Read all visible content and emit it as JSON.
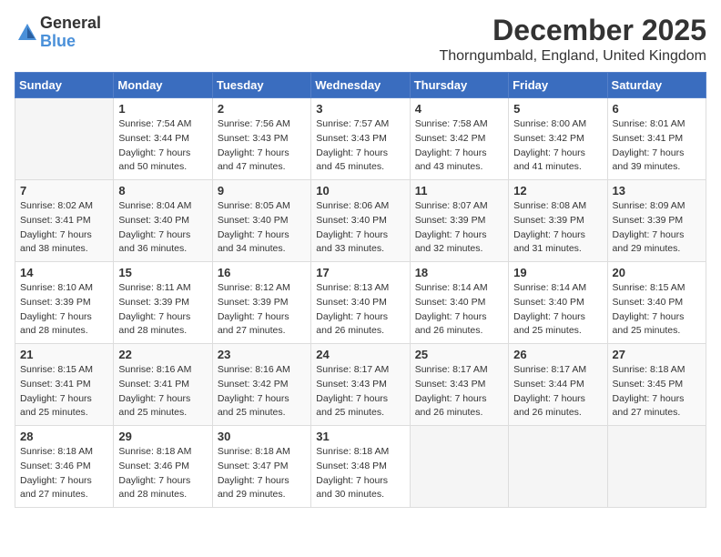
{
  "header": {
    "logo_general": "General",
    "logo_blue": "Blue",
    "month_year": "December 2025",
    "location": "Thorngumbald, England, United Kingdom"
  },
  "weekdays": [
    "Sunday",
    "Monday",
    "Tuesday",
    "Wednesday",
    "Thursday",
    "Friday",
    "Saturday"
  ],
  "weeks": [
    [
      {
        "day": "",
        "sunrise": "",
        "sunset": "",
        "daylight": ""
      },
      {
        "day": "1",
        "sunrise": "Sunrise: 7:54 AM",
        "sunset": "Sunset: 3:44 PM",
        "daylight": "Daylight: 7 hours and 50 minutes."
      },
      {
        "day": "2",
        "sunrise": "Sunrise: 7:56 AM",
        "sunset": "Sunset: 3:43 PM",
        "daylight": "Daylight: 7 hours and 47 minutes."
      },
      {
        "day": "3",
        "sunrise": "Sunrise: 7:57 AM",
        "sunset": "Sunset: 3:43 PM",
        "daylight": "Daylight: 7 hours and 45 minutes."
      },
      {
        "day": "4",
        "sunrise": "Sunrise: 7:58 AM",
        "sunset": "Sunset: 3:42 PM",
        "daylight": "Daylight: 7 hours and 43 minutes."
      },
      {
        "day": "5",
        "sunrise": "Sunrise: 8:00 AM",
        "sunset": "Sunset: 3:42 PM",
        "daylight": "Daylight: 7 hours and 41 minutes."
      },
      {
        "day": "6",
        "sunrise": "Sunrise: 8:01 AM",
        "sunset": "Sunset: 3:41 PM",
        "daylight": "Daylight: 7 hours and 39 minutes."
      }
    ],
    [
      {
        "day": "7",
        "sunrise": "Sunrise: 8:02 AM",
        "sunset": "Sunset: 3:41 PM",
        "daylight": "Daylight: 7 hours and 38 minutes."
      },
      {
        "day": "8",
        "sunrise": "Sunrise: 8:04 AM",
        "sunset": "Sunset: 3:40 PM",
        "daylight": "Daylight: 7 hours and 36 minutes."
      },
      {
        "day": "9",
        "sunrise": "Sunrise: 8:05 AM",
        "sunset": "Sunset: 3:40 PM",
        "daylight": "Daylight: 7 hours and 34 minutes."
      },
      {
        "day": "10",
        "sunrise": "Sunrise: 8:06 AM",
        "sunset": "Sunset: 3:40 PM",
        "daylight": "Daylight: 7 hours and 33 minutes."
      },
      {
        "day": "11",
        "sunrise": "Sunrise: 8:07 AM",
        "sunset": "Sunset: 3:39 PM",
        "daylight": "Daylight: 7 hours and 32 minutes."
      },
      {
        "day": "12",
        "sunrise": "Sunrise: 8:08 AM",
        "sunset": "Sunset: 3:39 PM",
        "daylight": "Daylight: 7 hours and 31 minutes."
      },
      {
        "day": "13",
        "sunrise": "Sunrise: 8:09 AM",
        "sunset": "Sunset: 3:39 PM",
        "daylight": "Daylight: 7 hours and 29 minutes."
      }
    ],
    [
      {
        "day": "14",
        "sunrise": "Sunrise: 8:10 AM",
        "sunset": "Sunset: 3:39 PM",
        "daylight": "Daylight: 7 hours and 28 minutes."
      },
      {
        "day": "15",
        "sunrise": "Sunrise: 8:11 AM",
        "sunset": "Sunset: 3:39 PM",
        "daylight": "Daylight: 7 hours and 28 minutes."
      },
      {
        "day": "16",
        "sunrise": "Sunrise: 8:12 AM",
        "sunset": "Sunset: 3:39 PM",
        "daylight": "Daylight: 7 hours and 27 minutes."
      },
      {
        "day": "17",
        "sunrise": "Sunrise: 8:13 AM",
        "sunset": "Sunset: 3:40 PM",
        "daylight": "Daylight: 7 hours and 26 minutes."
      },
      {
        "day": "18",
        "sunrise": "Sunrise: 8:14 AM",
        "sunset": "Sunset: 3:40 PM",
        "daylight": "Daylight: 7 hours and 26 minutes."
      },
      {
        "day": "19",
        "sunrise": "Sunrise: 8:14 AM",
        "sunset": "Sunset: 3:40 PM",
        "daylight": "Daylight: 7 hours and 25 minutes."
      },
      {
        "day": "20",
        "sunrise": "Sunrise: 8:15 AM",
        "sunset": "Sunset: 3:40 PM",
        "daylight": "Daylight: 7 hours and 25 minutes."
      }
    ],
    [
      {
        "day": "21",
        "sunrise": "Sunrise: 8:15 AM",
        "sunset": "Sunset: 3:41 PM",
        "daylight": "Daylight: 7 hours and 25 minutes."
      },
      {
        "day": "22",
        "sunrise": "Sunrise: 8:16 AM",
        "sunset": "Sunset: 3:41 PM",
        "daylight": "Daylight: 7 hours and 25 minutes."
      },
      {
        "day": "23",
        "sunrise": "Sunrise: 8:16 AM",
        "sunset": "Sunset: 3:42 PM",
        "daylight": "Daylight: 7 hours and 25 minutes."
      },
      {
        "day": "24",
        "sunrise": "Sunrise: 8:17 AM",
        "sunset": "Sunset: 3:43 PM",
        "daylight": "Daylight: 7 hours and 25 minutes."
      },
      {
        "day": "25",
        "sunrise": "Sunrise: 8:17 AM",
        "sunset": "Sunset: 3:43 PM",
        "daylight": "Daylight: 7 hours and 26 minutes."
      },
      {
        "day": "26",
        "sunrise": "Sunrise: 8:17 AM",
        "sunset": "Sunset: 3:44 PM",
        "daylight": "Daylight: 7 hours and 26 minutes."
      },
      {
        "day": "27",
        "sunrise": "Sunrise: 8:18 AM",
        "sunset": "Sunset: 3:45 PM",
        "daylight": "Daylight: 7 hours and 27 minutes."
      }
    ],
    [
      {
        "day": "28",
        "sunrise": "Sunrise: 8:18 AM",
        "sunset": "Sunset: 3:46 PM",
        "daylight": "Daylight: 7 hours and 27 minutes."
      },
      {
        "day": "29",
        "sunrise": "Sunrise: 8:18 AM",
        "sunset": "Sunset: 3:46 PM",
        "daylight": "Daylight: 7 hours and 28 minutes."
      },
      {
        "day": "30",
        "sunrise": "Sunrise: 8:18 AM",
        "sunset": "Sunset: 3:47 PM",
        "daylight": "Daylight: 7 hours and 29 minutes."
      },
      {
        "day": "31",
        "sunrise": "Sunrise: 8:18 AM",
        "sunset": "Sunset: 3:48 PM",
        "daylight": "Daylight: 7 hours and 30 minutes."
      },
      {
        "day": "",
        "sunrise": "",
        "sunset": "",
        "daylight": ""
      },
      {
        "day": "",
        "sunrise": "",
        "sunset": "",
        "daylight": ""
      },
      {
        "day": "",
        "sunrise": "",
        "sunset": "",
        "daylight": ""
      }
    ]
  ]
}
